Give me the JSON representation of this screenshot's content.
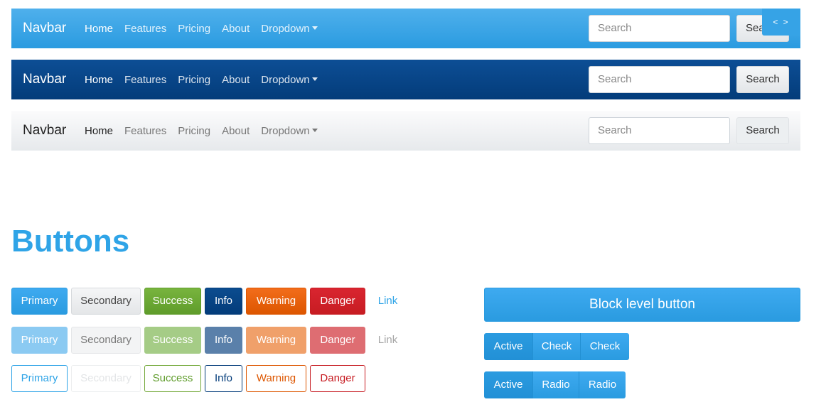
{
  "navbars": [
    {
      "brand": "Navbar",
      "links": [
        "Home",
        "Features",
        "Pricing",
        "About",
        "Dropdown"
      ],
      "search_placeholder": "Search",
      "search_button": "Sea"
    },
    {
      "brand": "Navbar",
      "links": [
        "Home",
        "Features",
        "Pricing",
        "About",
        "Dropdown"
      ],
      "search_placeholder": "Search",
      "search_button": "Search"
    },
    {
      "brand": "Navbar",
      "links": [
        "Home",
        "Features",
        "Pricing",
        "About",
        "Dropdown"
      ],
      "search_placeholder": "Search",
      "search_button": "Search"
    }
  ],
  "code_toggle": "< >",
  "section_title": "Buttons",
  "buttons": {
    "labels": [
      "Primary",
      "Secondary",
      "Success",
      "Info",
      "Warning",
      "Danger",
      "Link"
    ]
  },
  "block_button": "Block level button",
  "checkbox_group": [
    "Active",
    "Check",
    "Check"
  ],
  "radio_group": [
    "Active",
    "Radio",
    "Radio"
  ],
  "colors": {
    "primary": "#2fa4e7",
    "success": "#73a839",
    "info": "#033c7a",
    "warning": "#dd5600",
    "danger": "#c71c22"
  }
}
